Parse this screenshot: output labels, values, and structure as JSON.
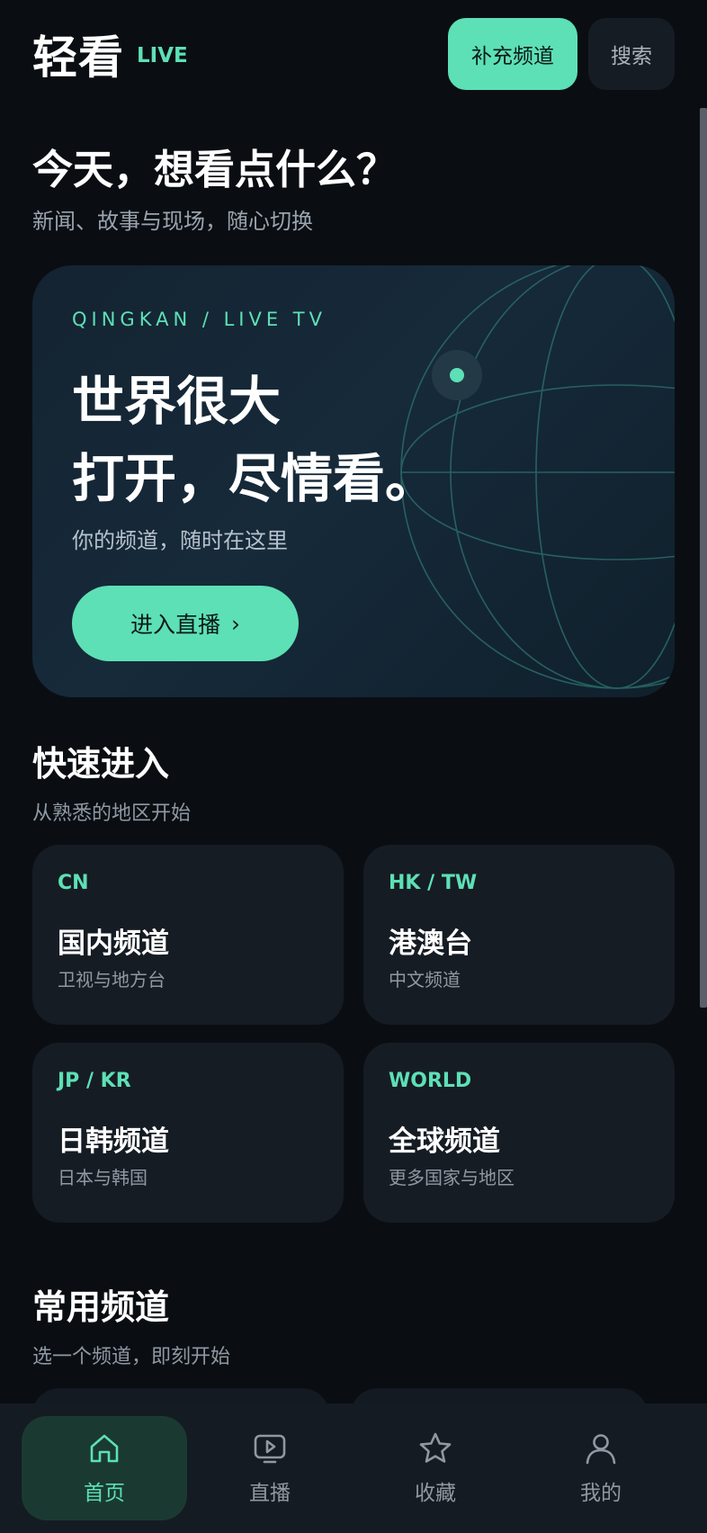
{
  "header": {
    "logo": "轻看",
    "live_tag": "LIVE",
    "add_channel_label": "补充频道",
    "search_label": "搜索"
  },
  "greeting": {
    "title": "今天，想看点什么？",
    "subtitle": "新闻、故事与现场，随心切换"
  },
  "hero": {
    "kicker": "QINGKAN / LIVE TV",
    "line1": "世界很大",
    "line2": "打开，尽情看。",
    "subtitle": "你的频道，随时在这里",
    "cta_label": "进入直播",
    "cta_arrow": "›"
  },
  "quick_entry": {
    "title": "快速进入",
    "subtitle": "从熟悉的地区开始",
    "tiles": [
      {
        "code": "CN",
        "name": "国内频道",
        "desc": "卫视与地方台"
      },
      {
        "code": "HK / TW",
        "name": "港澳台",
        "desc": "中文频道"
      },
      {
        "code": "JP / KR",
        "name": "日韩频道",
        "desc": "日本与韩国"
      },
      {
        "code": "WORLD",
        "name": "全球频道",
        "desc": "更多国家与地区"
      }
    ]
  },
  "frequent": {
    "title": "常用频道",
    "subtitle": "选一个频道，即刻开始"
  },
  "bottom_nav": {
    "items": [
      {
        "label": "首页",
        "icon": "home-icon",
        "active": true
      },
      {
        "label": "直播",
        "icon": "live-tv-icon",
        "active": false
      },
      {
        "label": "收藏",
        "icon": "star-icon",
        "active": false
      },
      {
        "label": "我的",
        "icon": "user-icon",
        "active": false
      }
    ]
  },
  "colors": {
    "accent": "#5de0b5",
    "background": "#0a0e13",
    "card": "#161c24"
  }
}
